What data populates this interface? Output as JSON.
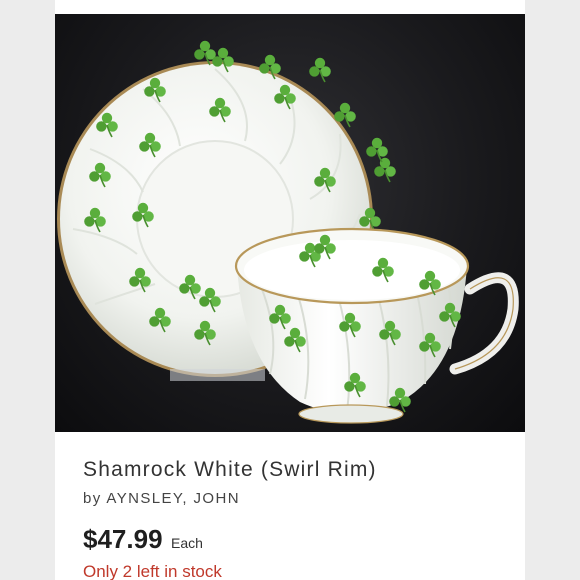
{
  "product": {
    "title": "Shamrock White (Swirl Rim)",
    "by_prefix": "by",
    "maker": "AYNSLEY, JOHN",
    "price": "$47.99",
    "price_unit": "Each",
    "stock_note": "Only 2 left in stock"
  },
  "photo": {
    "subject": "teacup-and-saucer",
    "pattern_icon": "shamrock-icon"
  },
  "colors": {
    "background": "#ffffff",
    "frame": "#ececec",
    "shamrock_green": "#5aae3c",
    "gold_rim": "#b8985a",
    "stock_red": "#c0392b"
  }
}
